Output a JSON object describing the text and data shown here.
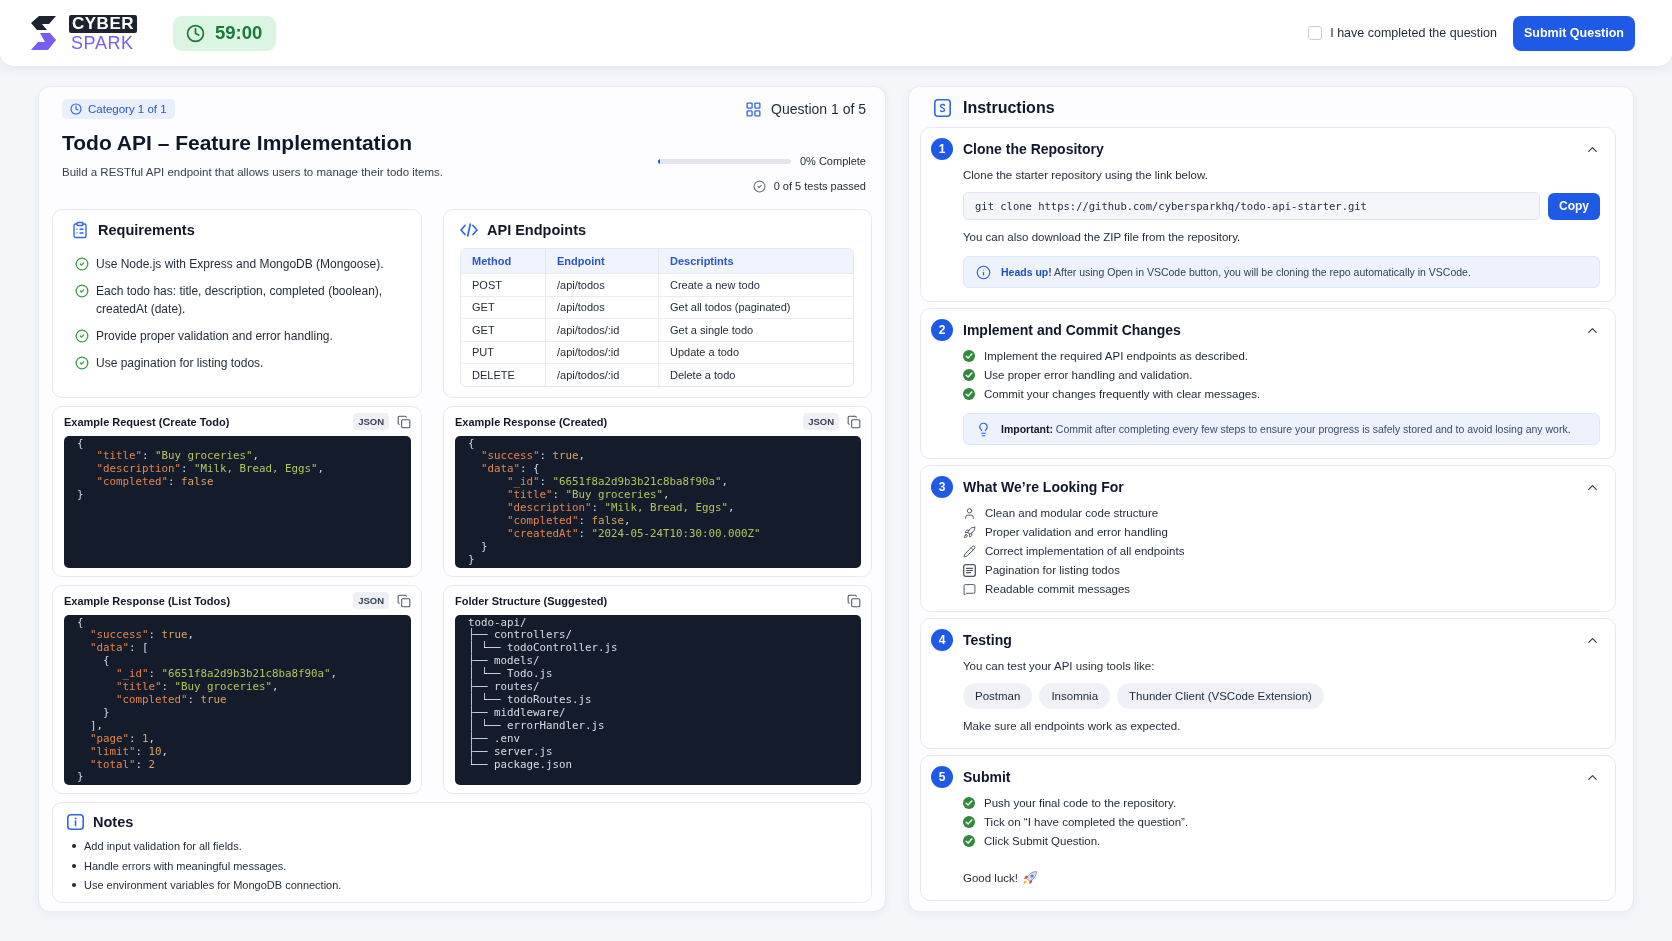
{
  "header": {
    "logo": {
      "top_word": "CYBER",
      "bottom_word": "SPARK"
    },
    "timer": "59:00",
    "completion": {
      "label": "I have completed the question",
      "checked": false
    },
    "submit_button": "Submit Question"
  },
  "question": {
    "category": "Category 1 of 1",
    "counter": "Question 1 of 5",
    "title": "Todo API – Feature Implementation",
    "description": "Build a RESTful API endpoint that allows users to manage their todo items.",
    "progress": {
      "level": 0,
      "label": "0% Complete"
    },
    "tests_passed": "0 of 5 tests passed"
  },
  "requirements": {
    "title": "Requirements",
    "items": [
      "Use Node.js with Express and MongoDB (Mongoose).",
      "Each todo has: title, description, completed (boolean), createdAt (date).",
      "Provide proper validation and error handling.",
      "Use pagination for listing todos."
    ]
  },
  "api_endpoints": {
    "title": "API Endpoints",
    "columns": [
      "Method",
      "Endpoint",
      "Descriptints"
    ],
    "rows": [
      [
        "POST",
        "/api/todos",
        "Create a new todo"
      ],
      [
        "GET",
        "/api/todos",
        "Get all todos (paginated)"
      ],
      [
        "GET",
        "/api/todos/:id",
        "Get a single todo"
      ],
      [
        "PUT",
        "/api/todos/:id",
        "Update a todo"
      ],
      [
        "DELETE",
        "/api/todos/:id",
        "Delete a todo"
      ]
    ]
  },
  "code_panels": [
    {
      "title": "Example Request (Create Todo)",
      "kind": "json",
      "badge": "JSON",
      "lines": [
        "{",
        "   \"title\": \"Buy groceries\",",
        "   \"description\": \"Milk, Bread, Eggs\",",
        "   \"completed\": false",
        "}"
      ]
    },
    {
      "title": "Example Response (Created)",
      "kind": "json",
      "badge": "JSON",
      "lines": [
        "{",
        "  \"success\": true,",
        "  \"data\": {",
        "      \"_id\": \"6651f8a2d9b3b21c8ba8f90a\",",
        "      \"title\": \"Buy groceries\",",
        "      \"description\": \"Milk, Bread, Eggs\",",
        "      \"completed\": false,",
        "      \"createdAt\": \"2024-05-24T10:30:00.000Z\"",
        "  }",
        "}"
      ]
    },
    {
      "title": "Example Response (List Todos)",
      "kind": "json",
      "badge": "JSON",
      "lines": [
        "{",
        "  \"success\": true,",
        "  \"data\": [",
        "    {",
        "      \"_id\": \"6651f8a2d9b3b21c8ba8f90a\",",
        "      \"title\": \"Buy groceries\",",
        "      \"completed\": true",
        "    }",
        "  ],",
        "  \"page\": 1,",
        "  \"limit\": 10,",
        "  \"total\": 2",
        "}"
      ]
    },
    {
      "title": "Folder Structure (Suggested)",
      "kind": "tree",
      "lines": [
        "todo-api/",
        "├── controllers/",
        "│ └── todoController.js",
        "├── models/",
        "│ └── Todo.js",
        "├── routes/",
        "│ └── todoRoutes.js",
        "├── middleware/",
        "│ └── errorHandler.js",
        "├── .env",
        "├── server.js",
        "└── package.json"
      ]
    }
  ],
  "notes": {
    "title": "Notes",
    "items": [
      "Add input validation for all fields.",
      "Handle errors with meaningful messages.",
      "Use environment variables for MongoDB connection."
    ]
  },
  "instructions": {
    "title": "Instructions",
    "steps": [
      {
        "number": "1",
        "title": "Clone the Repository",
        "expanded": true,
        "body": [
          {
            "kind": "text",
            "text": "Clone the starter repository using the link below."
          },
          {
            "kind": "command",
            "value": "git clone https://github.com/cybersparkhq/todo-api-starter.git",
            "button": "Copy"
          },
          {
            "kind": "text",
            "text": "You can also download the ZIP file from the repository."
          },
          {
            "kind": "info_alert",
            "text": "**Heads up!** After using Open in VSCode button, you will be cloning the repo automatically in VSCode."
          }
        ]
      },
      {
        "number": "2",
        "title": "Implement and Commit Changes",
        "expanded": true,
        "body": [
          {
            "kind": "checklist",
            "items": [
              "Implement the required API endpoints as described.",
              "Use proper error handling and validation.",
              "Commit your changes frequently with clear messages."
            ]
          },
          {
            "kind": "tip_alert",
            "text": "**Important:** Commit after completing every few steps to ensure your progress is safely stored and to avoid losing any work."
          }
        ]
      },
      {
        "number": "3",
        "title": "What We’re Looking For",
        "expanded": true,
        "body": [
          {
            "kind": "icon_list",
            "items": [
              "Clean and modular code structure",
              "Proper validation and error handling",
              "Correct implementation of all endpoints",
              "Pagination for listing todos",
              "Readable commit messages"
            ]
          }
        ]
      },
      {
        "number": "4",
        "title": "Testing",
        "expanded": true,
        "body": [
          {
            "kind": "text",
            "text": "You can test your API using tools like:"
          },
          {
            "kind": "chips",
            "items": [
              "Postman",
              "Insomnia",
              "Thunder Client (VSCode Extension)"
            ]
          },
          {
            "kind": "text",
            "text": "Make sure all endpoints work as expected."
          }
        ]
      },
      {
        "number": "5",
        "title": "Submit",
        "expanded": true,
        "body": [
          {
            "kind": "checklist",
            "items": [
              "Push your final code to the repository.",
              "Tick on “I have completed the question”.",
              "Click Submit Question."
            ]
          },
          {
            "kind": "closing",
            "text": "Good luck!"
          }
        ]
      }
    ]
  }
}
